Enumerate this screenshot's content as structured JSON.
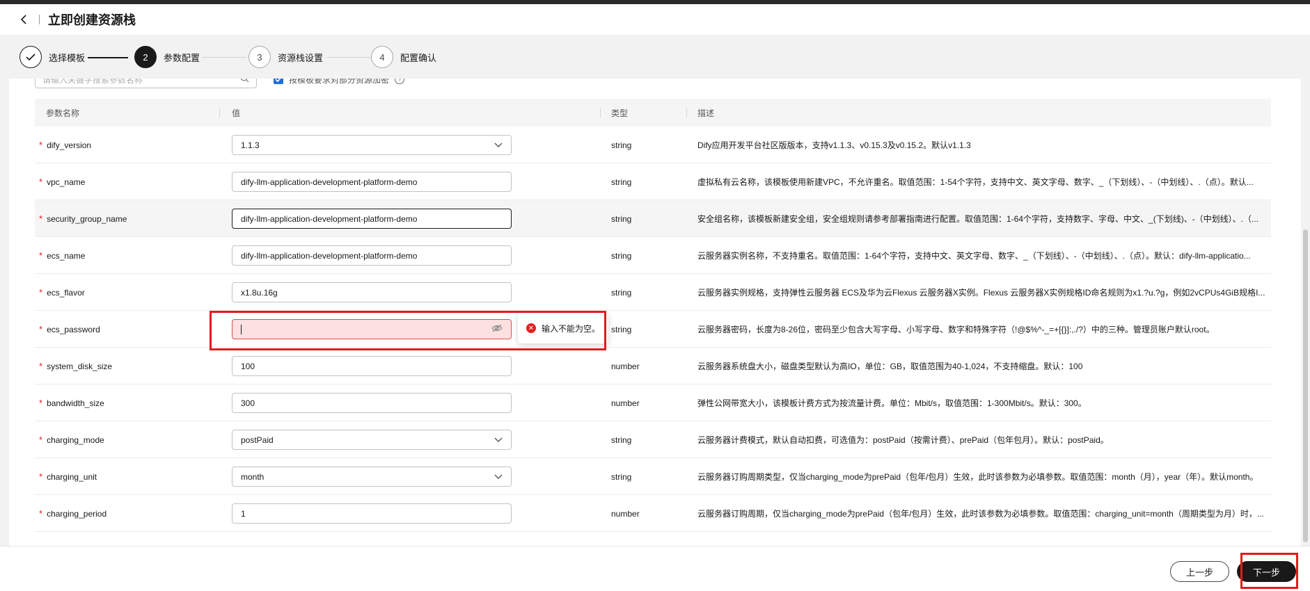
{
  "header": {
    "title": "立即创建资源栈"
  },
  "steps": [
    {
      "num": "",
      "label": "选择模板",
      "state": "done"
    },
    {
      "num": "2",
      "label": "参数配置",
      "state": "active"
    },
    {
      "num": "3",
      "label": "资源栈设置",
      "state": "todo"
    },
    {
      "num": "4",
      "label": "配置确认",
      "state": "todo"
    }
  ],
  "filter": {
    "search_placeholder": "请输入关键字搜索参数名称",
    "checkbox_label": "按模板要求对部分资源加密"
  },
  "table": {
    "columns": {
      "name": "参数名称",
      "value": "值",
      "type": "类型",
      "desc": "描述"
    },
    "rows": [
      {
        "name": "dify_version",
        "value": "1.1.3",
        "kind": "select",
        "type": "string",
        "desc": "Dify应用开发平台社区版版本，支持v1.1.3、v0.15.3及v0.15.2。默认v1.1.3"
      },
      {
        "name": "vpc_name",
        "value": "dify-llm-application-development-platform-demo",
        "kind": "text",
        "type": "string",
        "desc": "虚拟私有云名称，该模板使用新建VPC，不允许重名。取值范围：1-54个字符，支持中文、英文字母、数字、_（下划线）、-（中划线）、.（点）。默认..."
      },
      {
        "name": "security_group_name",
        "value": "dify-llm-application-development-platform-demo",
        "kind": "focused",
        "type": "string",
        "desc": "安全组名称，该模板新建安全组，安全组规则请参考部署指南进行配置。取值范围：1-64个字符，支持数字、字母、中文、_(下划线)、-（中划线）、.（..."
      },
      {
        "name": "ecs_name",
        "value": "dify-llm-application-development-platform-demo",
        "kind": "text",
        "type": "string",
        "desc": "云服务器实例名称，不支持重名。取值范围：1-64个字符，支持中文、英文字母、数字、_（下划线）、-（中划线）、.（点）。默认：dify-llm-applicatio..."
      },
      {
        "name": "ecs_flavor",
        "value": "x1.8u.16g",
        "kind": "text",
        "type": "string",
        "desc": "云服务器实例规格，支持弹性云服务器 ECS及华为云Flexus 云服务器X实例。Flexus 云服务器X实例规格ID命名规则为x1.?u.?g，例如2vCPUs4GiB规格I..."
      },
      {
        "name": "ecs_password",
        "value": "",
        "kind": "password-error",
        "type": "string",
        "desc": "云服务器密码，长度为8-26位，密码至少包含大写字母、小写字母、数字和特殊字符（!@$%^-_=+[{}]:,./?）中的三种。管理员账户默认root。"
      },
      {
        "name": "system_disk_size",
        "value": "100",
        "kind": "text",
        "type": "number",
        "desc": "云服务器系统盘大小，磁盘类型默认为高IO，单位：GB，取值范围为40-1,024，不支持缩盘。默认：100"
      },
      {
        "name": "bandwidth_size",
        "value": "300",
        "kind": "text",
        "type": "number",
        "desc": "弹性公网带宽大小，该模板计费方式为按流量计费。单位：Mbit/s，取值范围：1-300Mbit/s。默认：300。"
      },
      {
        "name": "charging_mode",
        "value": "postPaid",
        "kind": "select",
        "type": "string",
        "desc": "云服务器计费模式，默认自动扣费，可选值为：postPaid（按需计费）、prePaid（包年包月）。默认：postPaid。"
      },
      {
        "name": "charging_unit",
        "value": "month",
        "kind": "select",
        "type": "string",
        "desc": "云服务器订购周期类型，仅当charging_mode为prePaid（包年/包月）生效，此时该参数为必填参数。取值范围：month（月），year（年）。默认month。"
      },
      {
        "name": "charging_period",
        "value": "1",
        "kind": "text",
        "type": "number",
        "desc": "云服务器订购周期，仅当charging_mode为prePaid（包年/包月）生效，此时该参数为必填参数。取值范围：charging_unit=month（周期类型为月）时，..."
      }
    ]
  },
  "error_tip": "输入不能为空。",
  "footer": {
    "prev": "上一步",
    "next": "下一步"
  },
  "colors": {
    "error": "#e02020",
    "primary": "#191919",
    "highlight_box": "#e4191f"
  }
}
